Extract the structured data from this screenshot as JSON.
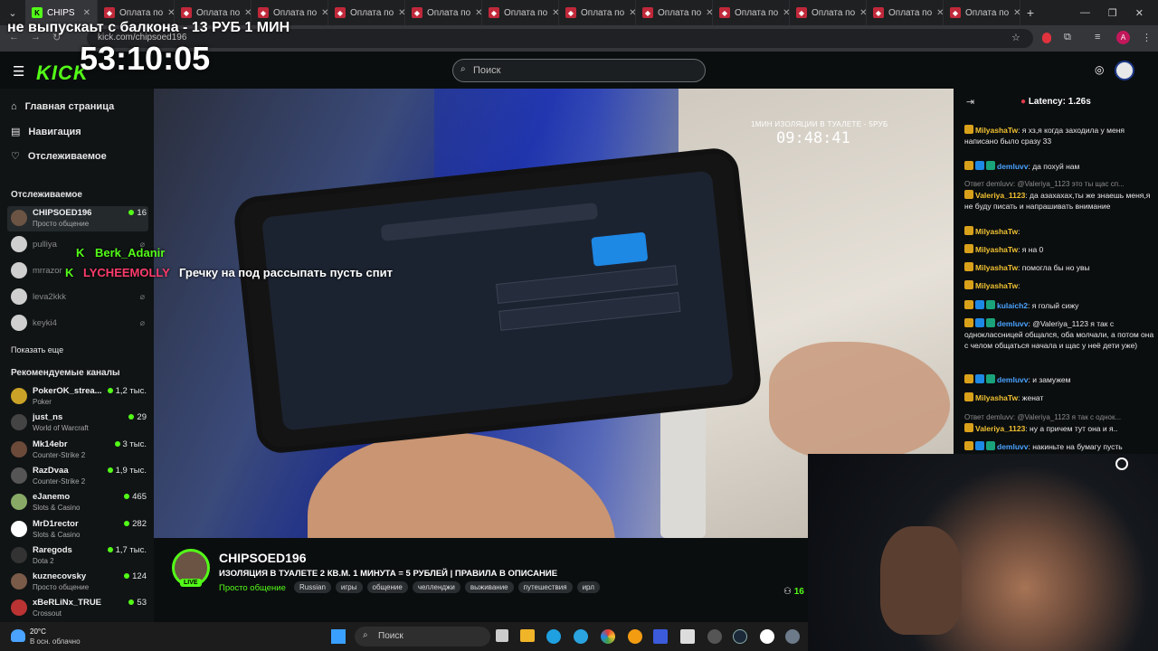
{
  "tabs": [
    {
      "title": "CHIPS"
    },
    {
      "title": "Оплата по"
    },
    {
      "title": "Оплата по"
    },
    {
      "title": "Оплата по"
    },
    {
      "title": "Оплата по"
    },
    {
      "title": "Оплата по"
    },
    {
      "title": "Оплата по"
    },
    {
      "title": "Оплата по"
    },
    {
      "title": "Оплата по"
    },
    {
      "title": "Оплата по"
    },
    {
      "title": "Оплата по"
    },
    {
      "title": "Оплата по"
    },
    {
      "title": "Оплата по"
    }
  ],
  "address": {
    "url": "kick.com/chipsoed196"
  },
  "header": {
    "logo": "KICK",
    "search_placeholder": "Поиск"
  },
  "overlay": {
    "banner": "не выпускаьт с балкона - 13 РУБ 1 МИН",
    "big_timer": "53:10:05",
    "video_title": "1МИН ИЗОЛЯЦИИ В ТУАЛЕТЕ - 5РУБ",
    "video_timer": "09:48:41",
    "chat1_user": "Berk_Adanir",
    "chat2_user": "LYCHEEMOLLY",
    "chat2_text": "Гречку на под рассыпать пусть спит"
  },
  "sidebar": {
    "nav": [
      {
        "label": "Главная страница"
      },
      {
        "label": "Навигация"
      },
      {
        "label": "Отслеживаемое"
      }
    ],
    "followed_title": "Отслеживаемое",
    "followed": [
      {
        "name": "CHIPSOED196",
        "game": "Просто общение",
        "viewers": "16"
      },
      {
        "name": "pulliya"
      },
      {
        "name": "mrrazor"
      },
      {
        "name": "leva2kkk"
      },
      {
        "name": "keyki4"
      }
    ],
    "show_more": "Показать еще",
    "recommended_title": "Рекомендуемые каналы",
    "recommended": [
      {
        "name": "PokerOK_strea...",
        "game": "Poker",
        "viewers": "1,2 тыс."
      },
      {
        "name": "just_ns",
        "game": "World of Warcraft",
        "viewers": "29"
      },
      {
        "name": "Mk14ebr",
        "game": "Counter-Strike 2",
        "viewers": "3 тыс."
      },
      {
        "name": "RazDvaa",
        "game": "Counter-Strike 2",
        "viewers": "1,9 тыс."
      },
      {
        "name": "eJanemo",
        "game": "Slots & Casino",
        "viewers": "465"
      },
      {
        "name": "MrD1rector",
        "game": "Slots & Casino",
        "viewers": "282"
      },
      {
        "name": "Raregods",
        "game": "Dota 2",
        "viewers": "1,7 тыс."
      },
      {
        "name": "kuznecovsky",
        "game": "Просто общение",
        "viewers": "124"
      },
      {
        "name": "xBeRLiNx_TRUE",
        "game": "Crossout",
        "viewers": "53"
      }
    ]
  },
  "stream": {
    "channel": "CHIPSOED196",
    "title": "ИЗОЛЯЦИЯ В ТУАЛЕТЕ 2 КВ.М. 1 МИНУТА = 5 РУБЛЕЙ | ПРАВИЛА В ОПИСАНИЕ",
    "category": "Просто общение",
    "tags": [
      "Russian",
      "игры",
      "общение",
      "челленджи",
      "выживание",
      "путешествия",
      "ирл"
    ],
    "viewers": "16",
    "live": "LIVE"
  },
  "chat": {
    "latency": "Latency: 1.26s",
    "messages": [
      {
        "user": "MilyashaTw",
        "text": ": я хз,я когда заходила у меня написано было сразу 33"
      },
      {
        "user": "demluvv",
        "text": ": да похуй нам"
      },
      {
        "reply": "Ответ demluvv: @Valeriya_1123 это ты щас сп...",
        "user": "Valeriya_1123",
        "text": ": да азахахах,ты же знаешь меня,я не буду писать и напрашивать внимание"
      },
      {
        "user": "MilyashaTw",
        "text": ":"
      },
      {
        "user": "MilyashaTw",
        "text": ": я на 0"
      },
      {
        "user": "MilyashaTw",
        "text": ": помогла бы но увы"
      },
      {
        "user": "MilyashaTw",
        "text": ":"
      },
      {
        "user": "kulaich2",
        "text": ": я голый сижу"
      },
      {
        "user": "demluvv",
        "text": ": @Valeriya_1123 я так с одноклассницей общался, оба молчали, а потом она с челом общаться начала и щас у неё дети уже)"
      },
      {
        "user": "demluvv",
        "text": ": и замужем"
      },
      {
        "user": "MilyashaTw",
        "text": ": женат"
      },
      {
        "reply": "Ответ demluvv: @Valeriya_1123 я так с однок...",
        "user": "Valeriya_1123",
        "text": ": ну а причем тут она и я.."
      },
      {
        "user": "demluvv",
        "text": ": накиньте на бумагу пусть"
      }
    ]
  },
  "taskbar": {
    "weather_temp": "20°C",
    "weather_desc": "В осн. облачно",
    "search": "Поиск"
  },
  "colors": {
    "accent": "#53fc18",
    "tab_fav": "#c0293a"
  }
}
